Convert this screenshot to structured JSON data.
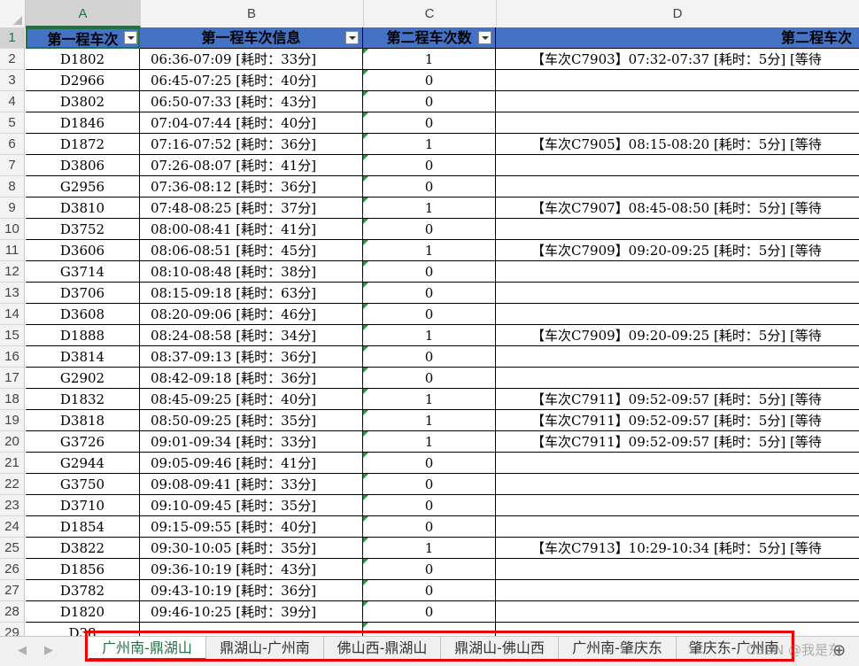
{
  "columns": [
    "A",
    "B",
    "C",
    "D"
  ],
  "header": {
    "a": "第一程车次",
    "b": "第一程车次信息",
    "c": "第二程车次数",
    "d": "第二程车次"
  },
  "rows": [
    {
      "n": "2",
      "a": "D1802",
      "b": "06:36-07:09 [耗时：33分]",
      "c": "1",
      "d": "【车次C7903】07:32-07:37 [耗时：5分] [等待"
    },
    {
      "n": "3",
      "a": "D2966",
      "b": "06:45-07:25 [耗时：40分]",
      "c": "0",
      "d": ""
    },
    {
      "n": "4",
      "a": "D3802",
      "b": "06:50-07:33 [耗时：43分]",
      "c": "0",
      "d": ""
    },
    {
      "n": "5",
      "a": "D1846",
      "b": "07:04-07:44 [耗时：40分]",
      "c": "0",
      "d": ""
    },
    {
      "n": "6",
      "a": "D1872",
      "b": "07:16-07:52 [耗时：36分]",
      "c": "1",
      "d": "【车次C7905】08:15-08:20 [耗时：5分] [等待"
    },
    {
      "n": "7",
      "a": "D3806",
      "b": "07:26-08:07 [耗时：41分]",
      "c": "0",
      "d": ""
    },
    {
      "n": "8",
      "a": "G2956",
      "b": "07:36-08:12 [耗时：36分]",
      "c": "0",
      "d": ""
    },
    {
      "n": "9",
      "a": "D3810",
      "b": "07:48-08:25 [耗时：37分]",
      "c": "1",
      "d": "【车次C7907】08:45-08:50 [耗时：5分] [等待"
    },
    {
      "n": "10",
      "a": "D3752",
      "b": "08:00-08:41 [耗时：41分]",
      "c": "0",
      "d": ""
    },
    {
      "n": "11",
      "a": "D3606",
      "b": "08:06-08:51 [耗时：45分]",
      "c": "1",
      "d": "【车次C7909】09:20-09:25 [耗时：5分] [等待"
    },
    {
      "n": "12",
      "a": "G3714",
      "b": "08:10-08:48 [耗时：38分]",
      "c": "0",
      "d": ""
    },
    {
      "n": "13",
      "a": "D3706",
      "b": "08:15-09:18 [耗时：63分]",
      "c": "0",
      "d": ""
    },
    {
      "n": "14",
      "a": "D3608",
      "b": "08:20-09:06 [耗时：46分]",
      "c": "0",
      "d": ""
    },
    {
      "n": "15",
      "a": "D1888",
      "b": "08:24-08:58 [耗时：34分]",
      "c": "1",
      "d": "【车次C7909】09:20-09:25 [耗时：5分] [等待"
    },
    {
      "n": "16",
      "a": "D3814",
      "b": "08:37-09:13 [耗时：36分]",
      "c": "0",
      "d": ""
    },
    {
      "n": "17",
      "a": "G2902",
      "b": "08:42-09:18 [耗时：36分]",
      "c": "0",
      "d": ""
    },
    {
      "n": "18",
      "a": "D1832",
      "b": "08:45-09:25 [耗时：40分]",
      "c": "1",
      "d": "【车次C7911】09:52-09:57 [耗时：5分] [等待"
    },
    {
      "n": "19",
      "a": "D3818",
      "b": "08:50-09:25 [耗时：35分]",
      "c": "1",
      "d": "【车次C7911】09:52-09:57 [耗时：5分] [等待"
    },
    {
      "n": "20",
      "a": "G3726",
      "b": "09:01-09:34 [耗时：33分]",
      "c": "1",
      "d": "【车次C7911】09:52-09:57 [耗时：5分] [等待"
    },
    {
      "n": "21",
      "a": "G2944",
      "b": "09:05-09:46 [耗时：41分]",
      "c": "0",
      "d": ""
    },
    {
      "n": "22",
      "a": "G3750",
      "b": "09:08-09:41 [耗时：33分]",
      "c": "0",
      "d": ""
    },
    {
      "n": "23",
      "a": "D3710",
      "b": "09:10-09:45 [耗时：35分]",
      "c": "0",
      "d": ""
    },
    {
      "n": "24",
      "a": "D1854",
      "b": "09:15-09:55 [耗时：40分]",
      "c": "0",
      "d": ""
    },
    {
      "n": "25",
      "a": "D3822",
      "b": "09:30-10:05 [耗时：35分]",
      "c": "1",
      "d": "【车次C7913】10:29-10:34 [耗时：5分] [等待"
    },
    {
      "n": "26",
      "a": "D1856",
      "b": "09:36-10:19 [耗时：43分]",
      "c": "0",
      "d": ""
    },
    {
      "n": "27",
      "a": "D3782",
      "b": "09:43-10:19 [耗时：36分]",
      "c": "0",
      "d": ""
    },
    {
      "n": "28",
      "a": "D1820",
      "b": "09:46-10:25 [耗时：39分]",
      "c": "0",
      "d": ""
    },
    {
      "n": "29",
      "a": "D38",
      "b": "",
      "c": "",
      "d": ""
    }
  ],
  "tabs": [
    "广州南-鼎湖山",
    "鼎湖山-广州南",
    "佛山西-鼎湖山",
    "鼎湖山-佛山西",
    "广州南-肇庆东",
    "肇庆东-广州南"
  ],
  "watermark": "CSDN @我是东"
}
